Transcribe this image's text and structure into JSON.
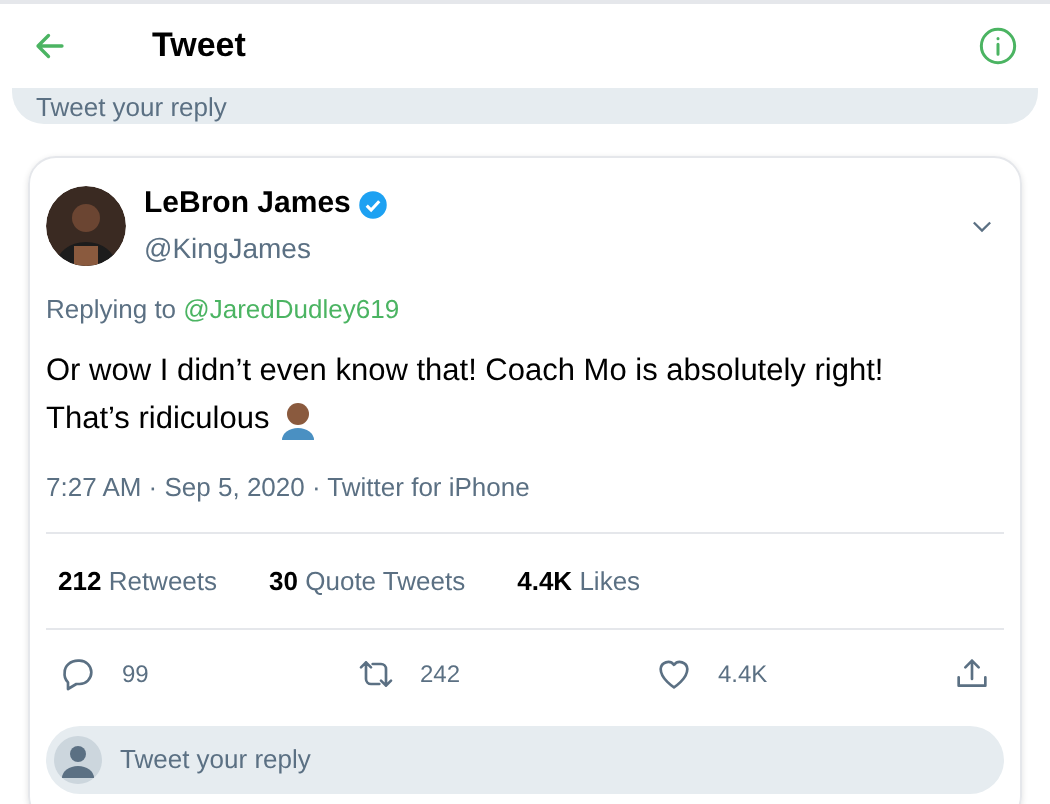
{
  "header": {
    "title": "Tweet"
  },
  "back_reply": {
    "placeholder": "Tweet your reply"
  },
  "tweet": {
    "name": "LeBron James",
    "verified": true,
    "handle": "@KingJames",
    "replying_label": "Replying to",
    "replying_to": "@JaredDudley619",
    "text": [
      "Or wow I didn’t even know that! Coach Mo is absolutely right!",
      "That’s ridiculous"
    ],
    "meta": "7:27 AM · Sep 5, 2020 · Twitter for iPhone",
    "stats": [
      {
        "value": "212",
        "label": "Retweets"
      },
      {
        "value": "30",
        "label": "Quote Tweets"
      },
      {
        "value": "4.4K",
        "label": "Likes"
      }
    ],
    "actions": [
      {
        "kind": "reply",
        "count": "99"
      },
      {
        "kind": "retweet",
        "count": "242"
      },
      {
        "kind": "like",
        "count": "4.4K"
      },
      {
        "kind": "share"
      }
    ]
  },
  "reply": {
    "placeholder": "Tweet your reply"
  }
}
